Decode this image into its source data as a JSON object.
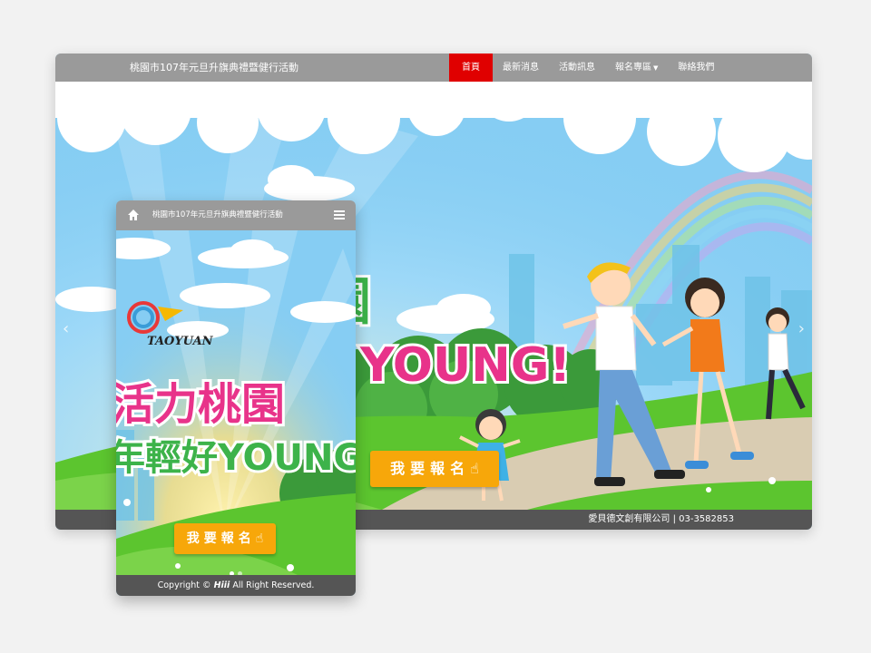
{
  "desktop": {
    "site_title": "桃園市107年元旦升旗典禮暨健行活動",
    "nav": [
      {
        "label": "首頁",
        "active": true
      },
      {
        "label": "最新消息",
        "active": false
      },
      {
        "label": "活動訊息",
        "active": false
      },
      {
        "label": "報名專區",
        "active": false,
        "dropdown": true
      },
      {
        "label": "聯絡我們",
        "active": false
      }
    ],
    "hero_banner_text": "YOUNG!",
    "cta_label": "我要報名",
    "footer_text": "愛貝德文創有限公司 | 03-3582853"
  },
  "mobile": {
    "site_title": "桃園市107年元旦升旗典禮暨健行活動",
    "logo_text": "TAOYUAN",
    "headline_line1": "活力桃園",
    "headline_line2": "年輕好YOUNG",
    "cta_label": "我要報名",
    "footer_prefix": "Copyright © ",
    "footer_brand": "Hiii",
    "footer_suffix": " All Right Reserved."
  },
  "colors": {
    "nav_bg": "#9a9a9a",
    "nav_active": "#e00000",
    "footer_bg": "#555555",
    "cta": "#f7a70a",
    "sky": "#8fd3f6",
    "grass": "#5cc52f",
    "headline_pink": "#e8338a",
    "headline_green": "#3db34a",
    "headline_yellow": "#f5c400"
  },
  "icons": [
    "home-icon",
    "hamburger-menu-icon",
    "chevron-left-icon",
    "chevron-right-icon",
    "pointing-hand-icon",
    "caret-down-icon"
  ]
}
